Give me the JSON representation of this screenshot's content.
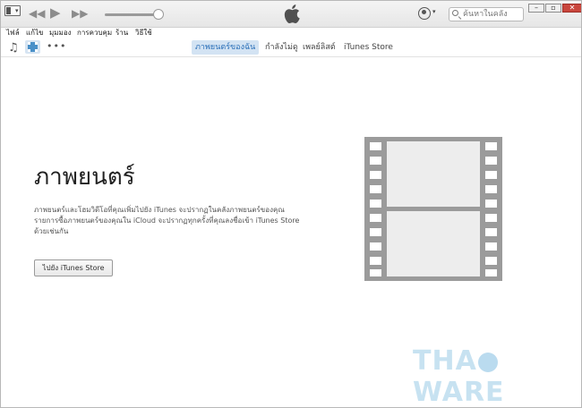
{
  "titlebar": {
    "search_placeholder": "ค้นหาในคลัง",
    "window_buttons": {
      "minimize": "–",
      "restore": "▫",
      "close": "✕"
    }
  },
  "menubar": {
    "items": [
      "ไฟล์",
      "แก้ไข",
      "มุมมอง",
      "การควบคุม",
      "ร้าน",
      "วิธีใช้"
    ]
  },
  "nav": {
    "tabs": [
      {
        "label": "ภาพยนตร์ของฉัน",
        "active": true
      },
      {
        "label": "กำลังไม่ดู",
        "active": false
      },
      {
        "label": "เพลย์ลิสต์",
        "active": false
      },
      {
        "label": "iTunes Store",
        "active": false
      }
    ]
  },
  "content": {
    "title": "ภาพยนตร์",
    "description": "ภาพยนตร์และโฮมวิดีโอที่คุณเพิ่มไปยัง iTunes จะปรากฏในคลังภาพยนตร์ของคุณ รายการซื้อภาพยนตร์ของคุณใน iCloud จะปรากฏทุกครั้งที่คุณลงชื่อเข้า iTunes Store ด้วยเช่นกัน",
    "store_button": "ไปยัง iTunes Store"
  },
  "watermark": {
    "left": "THA",
    "right": "WARE"
  },
  "colors": {
    "accent": "#2a6fb8",
    "film": "#9b9b9b",
    "tab_active_bg": "#d3e3f3"
  }
}
